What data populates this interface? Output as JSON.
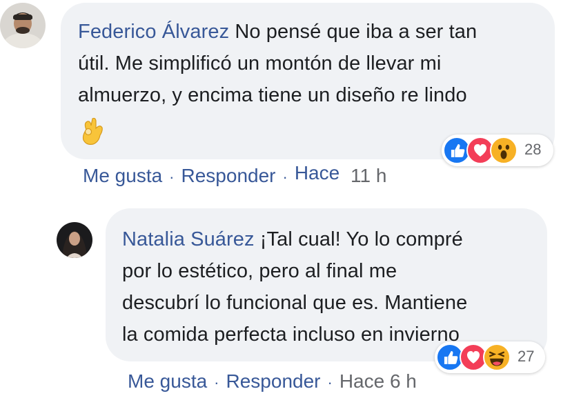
{
  "comments": [
    {
      "author": "Federico Álvarez",
      "text_lines": [
        "No pensé que iba a ser tan",
        "útil. Me simplificó un montón de llevar mi",
        "almuerzo, y encima tiene un diseño re lindo"
      ],
      "emoji_icon": "ok-hand-emoji",
      "reactions": {
        "icons": [
          "like-icon",
          "love-icon",
          "wow-icon"
        ],
        "count": "28"
      },
      "actions": {
        "like": "Me gusta",
        "reply": "Responder",
        "time_prefix": "Hace",
        "time_value": "11 h"
      }
    },
    {
      "author": "Natalia Suárez",
      "text_lines": [
        "¡Tal cual! Yo lo compré",
        "por lo estético, pero al final me",
        "descubrí lo funcional que es. Mantiene",
        "la comida perfecta incluso en invierno"
      ],
      "reactions": {
        "icons": [
          "like-icon",
          "love-icon",
          "haha-icon"
        ],
        "count": "27"
      },
      "actions": {
        "like": "Me gusta",
        "reply": "Responder",
        "time": "Hace 6 h"
      }
    }
  ],
  "colors": {
    "bubble": "#f0f2f5",
    "link": "#385898",
    "text": "#1c1e21",
    "meta": "#65676b",
    "like": "#1877f2",
    "love": "#f33e58",
    "wow": "#f7b125"
  }
}
